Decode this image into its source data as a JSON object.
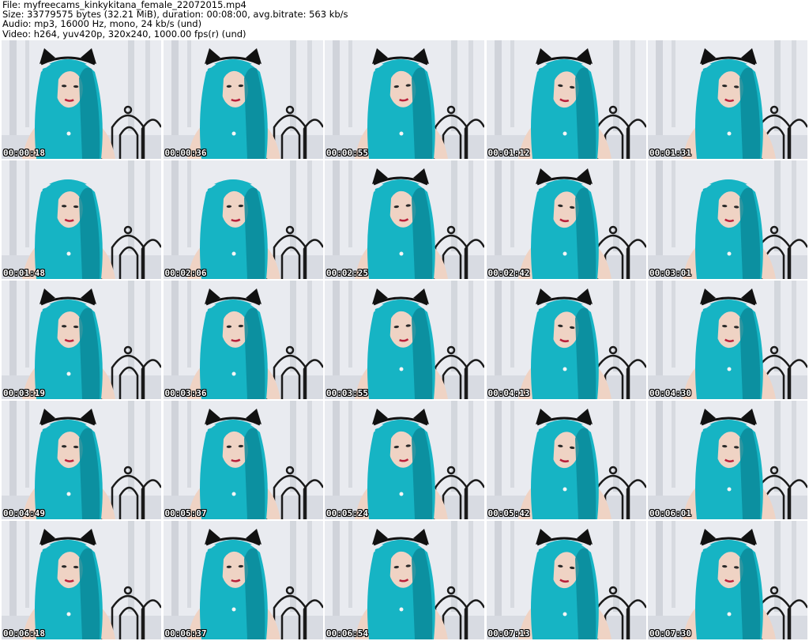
{
  "header": {
    "file_line": "File: myfreecams_kinkykitana_female_22072015.mp4",
    "size_line": "Size: 33779575 bytes (32.21 MiB), duration: 00:08:00, avg.bitrate: 563 kb/s",
    "audio_line": "Audio: mp3, 16000 Hz, mono, 24 kb/s (und)",
    "video_line": "Video: h264, yuv420p, 320x240, 1000.00 fps(r) (und)"
  },
  "colors": {
    "hair": "#16b4c4",
    "hair_dark": "#0a8a9a",
    "skin": "#efd3c4",
    "wall": "#e9ebf0",
    "trees": "#c5c9d0",
    "bed_frame": "#1a1a1a",
    "bra": "#111111",
    "ears": "#111111"
  },
  "thumbnails": [
    {
      "timestamp": "00:00:18",
      "ears": true,
      "bra": false
    },
    {
      "timestamp": "00:00:36",
      "ears": true,
      "bra": false
    },
    {
      "timestamp": "00:00:55",
      "ears": true,
      "bra": false
    },
    {
      "timestamp": "00:01:12",
      "ears": true,
      "bra": false
    },
    {
      "timestamp": "00:01:31",
      "ears": true,
      "bra": false
    },
    {
      "timestamp": "00:01:48",
      "ears": false,
      "bra": false
    },
    {
      "timestamp": "00:02:06",
      "ears": false,
      "bra": false
    },
    {
      "timestamp": "00:02:25",
      "ears": true,
      "bra": false
    },
    {
      "timestamp": "00:02:42",
      "ears": true,
      "bra": false
    },
    {
      "timestamp": "00:03:01",
      "ears": false,
      "bra": false
    },
    {
      "timestamp": "00:03:19",
      "ears": true,
      "bra": false
    },
    {
      "timestamp": "00:03:36",
      "ears": true,
      "bra": false
    },
    {
      "timestamp": "00:03:55",
      "ears": true,
      "bra": true
    },
    {
      "timestamp": "00:04:13",
      "ears": true,
      "bra": true
    },
    {
      "timestamp": "00:04:30",
      "ears": true,
      "bra": true
    },
    {
      "timestamp": "00:04:49",
      "ears": true,
      "bra": false
    },
    {
      "timestamp": "00:05:07",
      "ears": true,
      "bra": false
    },
    {
      "timestamp": "00:05:24",
      "ears": true,
      "bra": false
    },
    {
      "timestamp": "00:05:42",
      "ears": true,
      "bra": true
    },
    {
      "timestamp": "00:06:01",
      "ears": true,
      "bra": true
    },
    {
      "timestamp": "00:06:18",
      "ears": true,
      "bra": false
    },
    {
      "timestamp": "00:06:37",
      "ears": true,
      "bra": true
    },
    {
      "timestamp": "00:06:54",
      "ears": true,
      "bra": true
    },
    {
      "timestamp": "00:07:13",
      "ears": true,
      "bra": false
    },
    {
      "timestamp": "00:07:30",
      "ears": true,
      "bra": false
    }
  ]
}
